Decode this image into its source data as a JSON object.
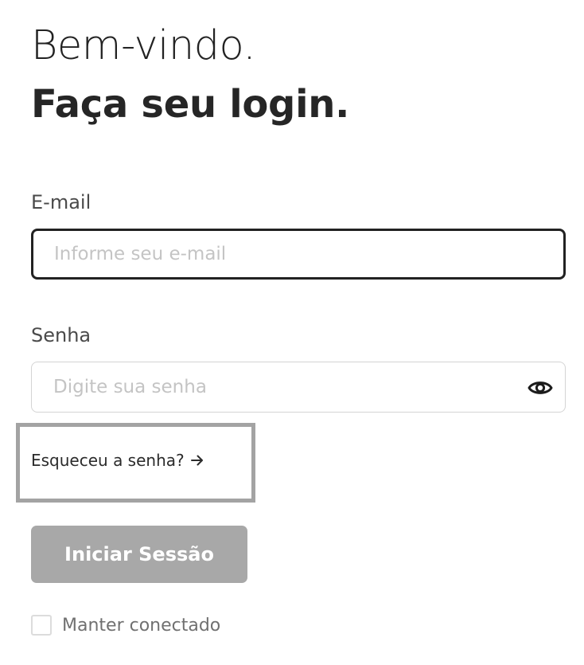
{
  "header": {
    "greeting": "Bem-vindo.",
    "headline": "Faça seu login."
  },
  "form": {
    "email": {
      "label": "E-mail",
      "placeholder": "Informe seu e-mail",
      "value": ""
    },
    "password": {
      "label": "Senha",
      "placeholder": "Digite sua senha",
      "value": "",
      "toggle_icon": "eye-icon"
    },
    "forgot_password": {
      "label": "Esqueceu a senha?",
      "icon": "arrow-right-icon"
    },
    "submit_label": "Iniciar Sessão",
    "remember_me": {
      "label": "Manter conectado",
      "checked": false
    }
  },
  "colors": {
    "text_dark": "#222222",
    "label": "#4a4a4a",
    "placeholder": "#c4c4c4",
    "button_disabled": "#a8a8a8",
    "focus_border": "#222222",
    "highlight_frame": "#a3a3a3"
  }
}
